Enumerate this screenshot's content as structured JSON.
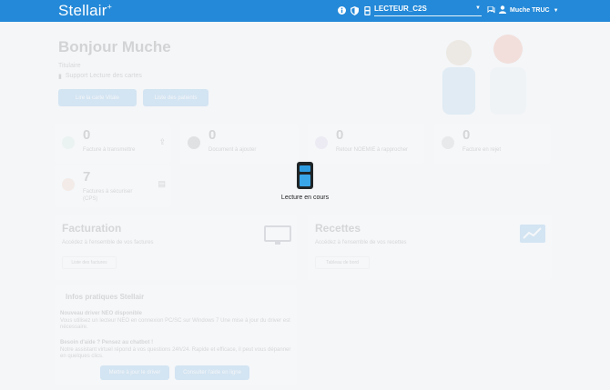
{
  "app": {
    "brand": "Stellair",
    "brand_mark": "+"
  },
  "topbar": {
    "icons": [
      "info-icon",
      "shield-icon",
      "card-reader-icon"
    ],
    "reader": {
      "value": "LECTEUR_C2S"
    },
    "user": {
      "name": "Muche TRUC"
    },
    "colors": {
      "accent": "#2489d8"
    }
  },
  "home": {
    "greeting": "Bonjour Muche",
    "role": "Titulaire",
    "support": "Support Lecture des cartes",
    "actions": {
      "read_card": "Lire la carte Vitale",
      "list_patients": "Liste des patients"
    }
  },
  "stats": [
    {
      "count": "0",
      "label": "Facture à transmettre"
    },
    {
      "count": "0",
      "label": "Document à ajouter"
    },
    {
      "count": "0",
      "label": "Retour NOEMIE à rapprocher"
    },
    {
      "count": "0",
      "label": "Facture en rejet"
    },
    {
      "count": "7",
      "label": "Factures à sécuriser (CPS)"
    }
  ],
  "sections": {
    "billing": {
      "title": "Facturation",
      "desc": "Accédez à l'ensemble de vos factures",
      "link": "Liste des factures"
    },
    "receipts": {
      "title": "Recettes",
      "desc": "Accédez à l'ensemble de vos recettes",
      "link": "Tableau de bord"
    }
  },
  "info": {
    "title": "Infos pratiques Stellair",
    "driver_title": "Nouveau driver NEO disponible",
    "driver_text": "Vous utilisez un lecteur NEO en connexion PC/SC sur Windows 7 Une mise à jour du driver est nécessaire.",
    "help_title": "Besoin d'aide ? Pensez au chatbot !",
    "help_text": "Notre assistant virtuel répond à vos questions 24h/24. Rapide et efficace, il peut vous dépanner en quelques clics.",
    "btn_update": "Mettre à jour le driver",
    "btn_chat": "Consulter l'aide en ligne"
  },
  "overlay": {
    "status": "Lecture en cours"
  }
}
